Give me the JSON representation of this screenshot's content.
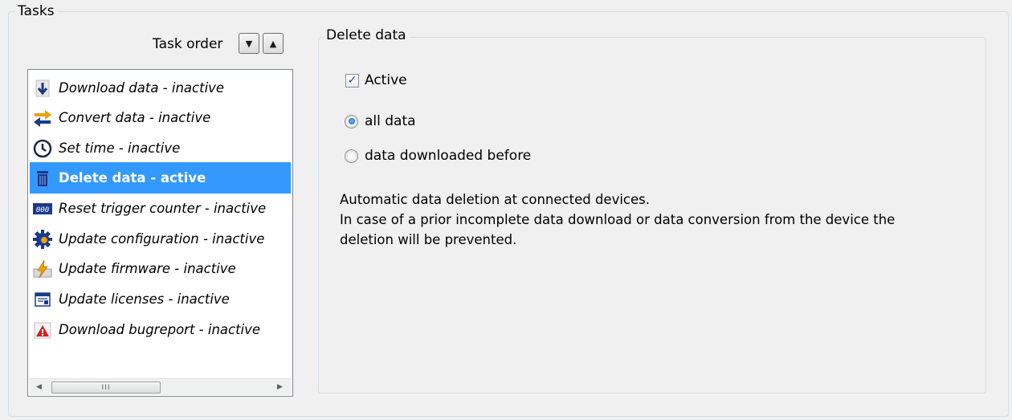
{
  "tasks_group": {
    "title": "Tasks",
    "order_label": "Task order",
    "order_down_glyph": "▼",
    "order_up_glyph": "▲"
  },
  "task_list": {
    "items": [
      {
        "label": "Download data - inactive",
        "icon": "download-icon",
        "selected": false
      },
      {
        "label": "Convert data - inactive",
        "icon": "convert-arrows-icon",
        "selected": false
      },
      {
        "label": "Set time - inactive",
        "icon": "clock-icon",
        "selected": false
      },
      {
        "label": "Delete data - active",
        "icon": "trash-icon",
        "selected": true
      },
      {
        "label": "Reset trigger counter - inactive",
        "icon": "counter-icon",
        "selected": false
      },
      {
        "label": "Update configuration - inactive",
        "icon": "gear-icon",
        "selected": false
      },
      {
        "label": "Update firmware - inactive",
        "icon": "firmware-lightning-icon",
        "selected": false
      },
      {
        "label": "Update licenses - inactive",
        "icon": "license-icon",
        "selected": false
      },
      {
        "label": "Download bugreport - inactive",
        "icon": "bugreport-icon",
        "selected": false
      }
    ],
    "scroll_thumb_grip": "III"
  },
  "delete_panel": {
    "title": "Delete data",
    "active_label": "Active",
    "active_checked": true,
    "options": [
      {
        "label": "all data",
        "selected": true
      },
      {
        "label": "data downloaded before",
        "selected": false
      }
    ],
    "description_lines": [
      "Automatic data deletion at connected devices.",
      "In case of a prior incomplete data download or data conversion from the device the",
      "deletion will be prevented."
    ]
  },
  "colors": {
    "selection": "#3399ff",
    "window_bg": "#f0f0f0"
  }
}
